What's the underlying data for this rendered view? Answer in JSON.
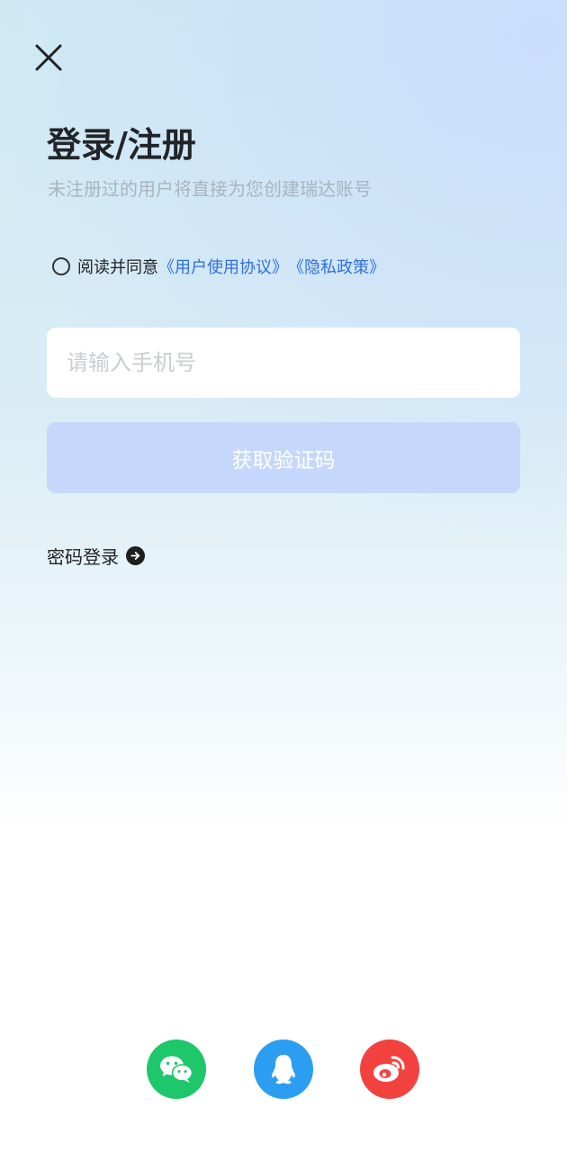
{
  "header": {
    "close_icon": "close-icon"
  },
  "login": {
    "title": "登录/注册",
    "subtitle": "未注册过的用户将直接为您创建瑞达账号"
  },
  "agreement": {
    "checked": false,
    "prefix": "阅读并同意",
    "terms_link": "《用户使用协议》",
    "privacy_link": "《隐私政策》",
    "link_color": "#2f6fe0"
  },
  "phone": {
    "value": "",
    "placeholder": "请输入手机号"
  },
  "get_code": {
    "label": "获取验证码",
    "color": "#c5d8fb"
  },
  "password_login": {
    "label": "密码登录",
    "icon": "arrow-right-circle-icon"
  },
  "social_login": [
    {
      "name": "wechat",
      "icon": "wechat-icon",
      "color": "#1ec76a"
    },
    {
      "name": "qq",
      "icon": "qq-icon",
      "color": "#2c9ef2"
    },
    {
      "name": "weibo",
      "icon": "weibo-icon",
      "color": "#f2423f"
    }
  ]
}
